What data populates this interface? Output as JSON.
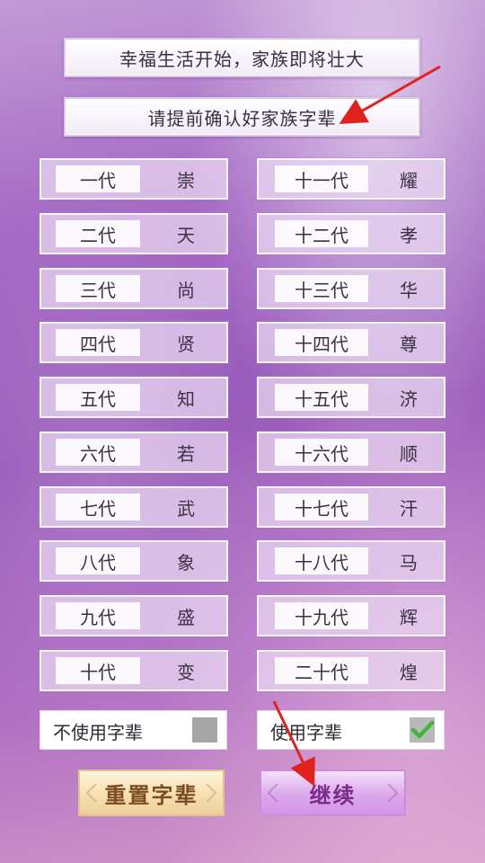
{
  "banner": {
    "line1": "幸福生活开始，家族即将壮大",
    "line2": "请提前确认好家族字辈"
  },
  "generations_left": [
    {
      "label": "一代",
      "char": "崇"
    },
    {
      "label": "二代",
      "char": "天"
    },
    {
      "label": "三代",
      "char": "尚"
    },
    {
      "label": "四代",
      "char": "贤"
    },
    {
      "label": "五代",
      "char": "知"
    },
    {
      "label": "六代",
      "char": "若"
    },
    {
      "label": "七代",
      "char": "武"
    },
    {
      "label": "八代",
      "char": "象"
    },
    {
      "label": "九代",
      "char": "盛"
    },
    {
      "label": "十代",
      "char": "变"
    }
  ],
  "generations_right": [
    {
      "label": "十一代",
      "char": "耀"
    },
    {
      "label": "十二代",
      "char": "孝"
    },
    {
      "label": "十三代",
      "char": "华"
    },
    {
      "label": "十四代",
      "char": "尊"
    },
    {
      "label": "十五代",
      "char": "济"
    },
    {
      "label": "十六代",
      "char": "顺"
    },
    {
      "label": "十七代",
      "char": "汗"
    },
    {
      "label": "十八代",
      "char": "马"
    },
    {
      "label": "十九代",
      "char": "辉"
    },
    {
      "label": "二十代",
      "char": "煌"
    }
  ],
  "options": {
    "no_use": {
      "label": "不使用字辈",
      "checked": false
    },
    "use": {
      "label": "使用字辈",
      "checked": true
    }
  },
  "buttons": {
    "reset": "重置字辈",
    "continue": "继续"
  },
  "colors": {
    "accent_red_arrow": "#e0221f",
    "check_green": "#3fb83a"
  }
}
